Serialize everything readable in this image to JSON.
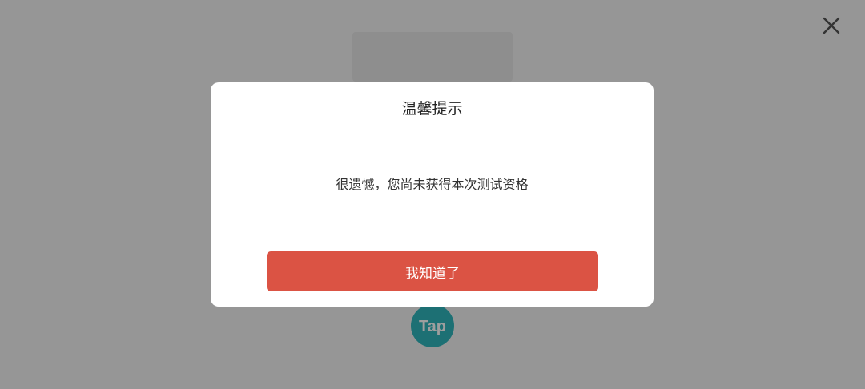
{
  "dialog": {
    "title": "温馨提示",
    "message": "很遗憾，您尚未获得本次测试资格",
    "confirm_label": "我知道了"
  },
  "logo": {
    "text": "Tap",
    "color": "#2fb5bb"
  },
  "icons": {
    "close": "close-icon"
  },
  "colors": {
    "accent": "#db5344",
    "overlay": "rgba(0,0,0,0.38)"
  }
}
